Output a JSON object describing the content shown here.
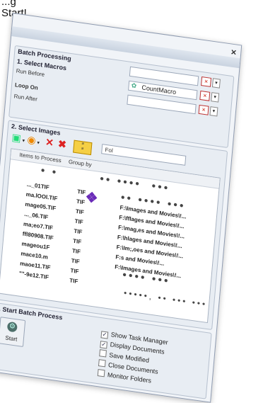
{
  "caption": {
    "line1": "...g",
    "line2": "Start!"
  },
  "window": {
    "close": "×"
  },
  "batch": {
    "title": "Batch Processing",
    "section1": "1. Select Macros",
    "run_before": "Run Before",
    "loop_on": "Loop On",
    "run_after": "Run After",
    "macro": "CountMacro",
    "x": "×",
    "dd": "▾"
  },
  "images": {
    "section2": "2. Select Images",
    "folder": "Fol",
    "col_items": "Items to Process",
    "col_group": "Group by",
    "rows": [
      {
        "name": "..._01TIF",
        "type": "TIF",
        "path": ""
      },
      {
        "name": "ma.lOOl.TIF",
        "type": "TIF",
        "path": "F:\\Images and Movies\\!..."
      },
      {
        "name": "mage05.TIF",
        "type": "TIF",
        "path": "F:\\fflages and Movies\\!..."
      },
      {
        "name": "..._06.TIF",
        "type": "TIF",
        "path": "F:\\mag,es and Movies\\!..."
      },
      {
        "name": "ma;eo7.TIF",
        "type": "TIF",
        "path": "F:\\hlages and Movies\\!..."
      },
      {
        "name": "ffl80908.TIF",
        "type": "TIF",
        "path": "F:\\Im;,oes and Movies\\!..."
      },
      {
        "name": "mageou1F",
        "type": "TIF",
        "path": "F:s and Movies\\!..."
      },
      {
        "name": "mace10.m",
        "type": "TIF",
        "path": "F:\\Images and Movies\\!..."
      },
      {
        "name": "maoe11.TIF",
        "type": "TIF",
        "path": ""
      },
      {
        "name": "\"\"-9e12.TIF",
        "type": "TIF",
        "path": ""
      }
    ]
  },
  "process": {
    "section3": "3. Start Batch Process",
    "start": "Start",
    "options": [
      {
        "label": "Show Task Manager",
        "checked": true
      },
      {
        "label": "Display Documents",
        "checked": true
      },
      {
        "label": "Save Modified",
        "checked": false
      },
      {
        "label": "Close Documents",
        "checked": false
      },
      {
        "label": "Monitor Folders",
        "checked": false
      }
    ]
  },
  "icons": [
    "close-icon",
    "gear-icon",
    "add-image-icon",
    "add-folder-icon",
    "remove-icon",
    "remove-all-icon",
    "sort-icon",
    "start-gear-icon"
  ]
}
